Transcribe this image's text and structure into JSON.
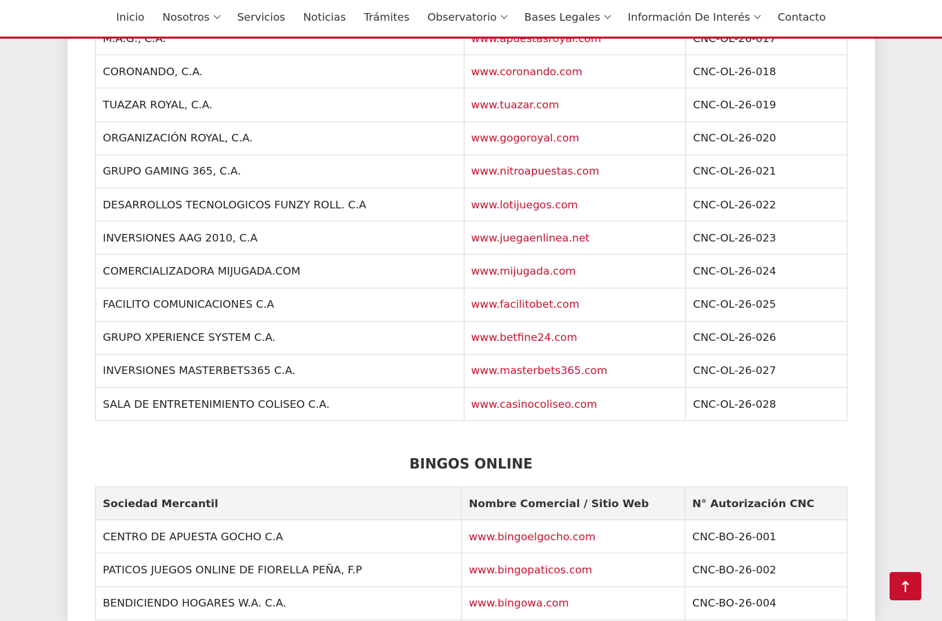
{
  "nav": {
    "items": [
      {
        "label": "Inicio",
        "dropdown": false
      },
      {
        "label": "Nosotros",
        "dropdown": true
      },
      {
        "label": "Servicios",
        "dropdown": false
      },
      {
        "label": "Noticias",
        "dropdown": false
      },
      {
        "label": "Trámites",
        "dropdown": false
      },
      {
        "label": "Observatorio",
        "dropdown": true
      },
      {
        "label": "Bases Legales",
        "dropdown": true
      },
      {
        "label": "Información De Interés",
        "dropdown": true
      },
      {
        "label": "Contacto",
        "dropdown": false
      }
    ]
  },
  "online_table": {
    "rows": [
      {
        "company": "M.A.G., C.A.",
        "site": "www.apuestasroyal.com",
        "auth": "CNC-OL-26-017"
      },
      {
        "company": "CORONANDO, C.A.",
        "site": "www.coronando.com",
        "auth": "CNC-OL-26-018"
      },
      {
        "company": "TUAZAR ROYAL, C.A.",
        "site": "www.tuazar.com",
        "auth": "CNC-OL-26-019"
      },
      {
        "company": "ORGANIZACIÓN ROYAL, C.A.",
        "site": "www.gogoroyal.com",
        "auth": "CNC-OL-26-020"
      },
      {
        "company": "GRUPO GAMING 365, C.A.",
        "site": "www.nitroapuestas.com",
        "auth": "CNC-OL-26-021"
      },
      {
        "company": "DESARROLLOS TECNOLOGICOS FUNZY ROLL. C.A",
        "site": "www.lotijuegos.com",
        "auth": "CNC-OL-26-022"
      },
      {
        "company": "INVERSIONES AAG 2010, C.A",
        "site": "www.juegaenlinea.net",
        "auth": "CNC-OL-26-023"
      },
      {
        "company": "COMERCIALIZADORA MIJUGADA.COM",
        "site": "www.mijugada.com",
        "auth": "CNC-OL-26-024"
      },
      {
        "company": "FACILITO COMUNICACIONES C.A",
        "site": "www.facilitobet.com",
        "auth": "CNC-OL-26-025"
      },
      {
        "company": "GRUPO XPERIENCE SYSTEM C.A.",
        "site": "www.betfine24.com",
        "auth": "CNC-OL-26-026"
      },
      {
        "company": "INVERSIONES MASTERBETS365 C.A.",
        "site": "www.masterbets365.com",
        "auth": "CNC-OL-26-027"
      },
      {
        "company": "SALA DE ENTRETENIMIENTO COLISEO C.A.",
        "site": "www.casinocoliseo.com",
        "auth": "CNC-OL-26-028"
      }
    ]
  },
  "bingo_section": {
    "title": "BINGOS ONLINE",
    "headers": {
      "company": "Sociedad Mercantil",
      "site": "Nombre Comercial / Sitio Web",
      "auth": "N° Autorización CNC"
    },
    "rows": [
      {
        "company": "CENTRO DE APUESTA GOCHO C.A",
        "site": "www.bingoelgocho.com",
        "auth": "CNC-BO-26-001"
      },
      {
        "company": "PATICOS JUEGOS ONLINE DE FIORELLA PEÑA, F.P",
        "site": "www.bingopaticos.com",
        "auth": "CNC-BO-26-002"
      },
      {
        "company": "BENDICIENDO HOGARES W.A. C.A.",
        "site": "www.bingowa.com",
        "auth": "CNC-BO-26-004"
      }
    ]
  },
  "scroll_top": {
    "icon": "arrow-up-icon"
  },
  "colors": {
    "accent": "#c8102e",
    "text": "#333333",
    "border": "#dcdcdc"
  }
}
